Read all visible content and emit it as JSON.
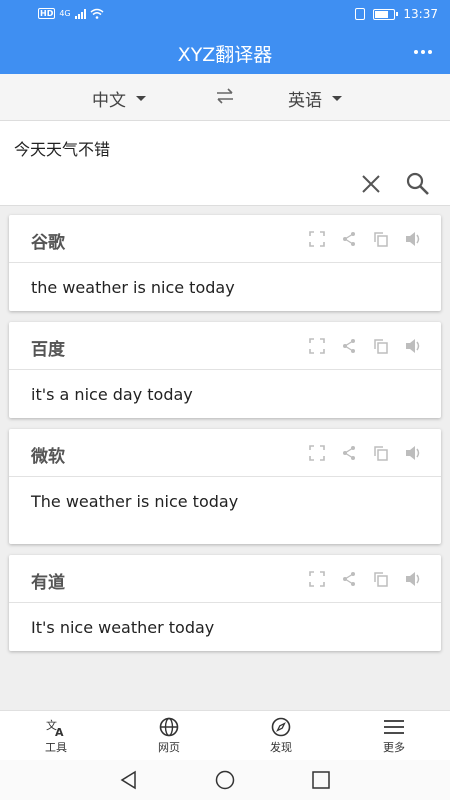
{
  "status": {
    "badge_hd": "HD",
    "network": "4G",
    "time": "13:37",
    "battery_level": 0.75
  },
  "header": {
    "title": "XYZ翻译器"
  },
  "languages": {
    "source": "中文",
    "target": "英语"
  },
  "input": {
    "text": "今天天气不错"
  },
  "results": [
    {
      "engine": "谷歌",
      "translation": "the weather is nice today"
    },
    {
      "engine": "百度",
      "translation": "it's a nice day today"
    },
    {
      "engine": "微软",
      "translation": "The weather is nice today"
    },
    {
      "engine": "有道",
      "translation": "It's nice weather today"
    }
  ],
  "nav": {
    "tools": "工具",
    "web": "网页",
    "discover": "发现",
    "more": "更多"
  },
  "colors": {
    "primary": "#3f8ff2",
    "icon_gray": "#bdbdbd"
  }
}
